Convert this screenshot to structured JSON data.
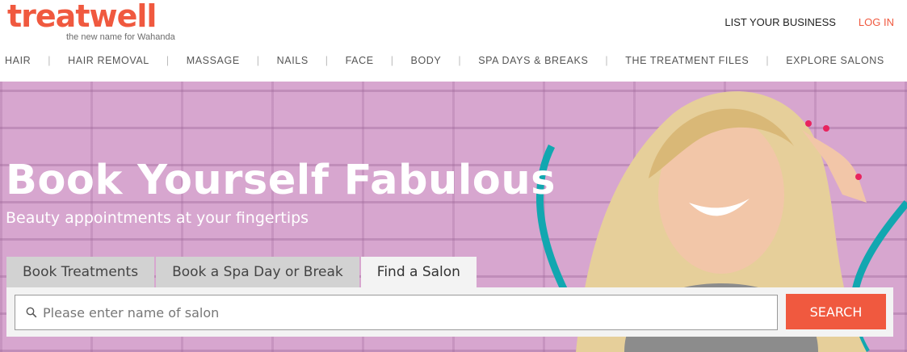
{
  "brand": {
    "name": "treatwell",
    "tagline": "the new name for Wahanda",
    "accent": "#f0593f"
  },
  "top_links": {
    "list_business": "LIST YOUR BUSINESS",
    "login": "LOG IN"
  },
  "nav": {
    "items": [
      {
        "label": "HAIR"
      },
      {
        "label": "HAIR REMOVAL"
      },
      {
        "label": "MASSAGE"
      },
      {
        "label": "NAILS"
      },
      {
        "label": "FACE"
      },
      {
        "label": "BODY"
      },
      {
        "label": "SPA DAYS & BREAKS"
      },
      {
        "label": "THE TREATMENT FILES"
      },
      {
        "label": "EXPLORE SALONS"
      }
    ]
  },
  "hero": {
    "headline": "Book Yourself Fabulous",
    "subline": "Beauty appointments at your fingertips",
    "image": "smiling-woman-brick-wall"
  },
  "search": {
    "tabs": [
      {
        "label": "Book Treatments",
        "active": false
      },
      {
        "label": "Book a Spa Day or Break",
        "active": false
      },
      {
        "label": "Find a Salon",
        "active": true
      }
    ],
    "placeholder": "Please enter name of salon",
    "value": "",
    "button_label": "SEARCH",
    "icon": "search-icon"
  }
}
